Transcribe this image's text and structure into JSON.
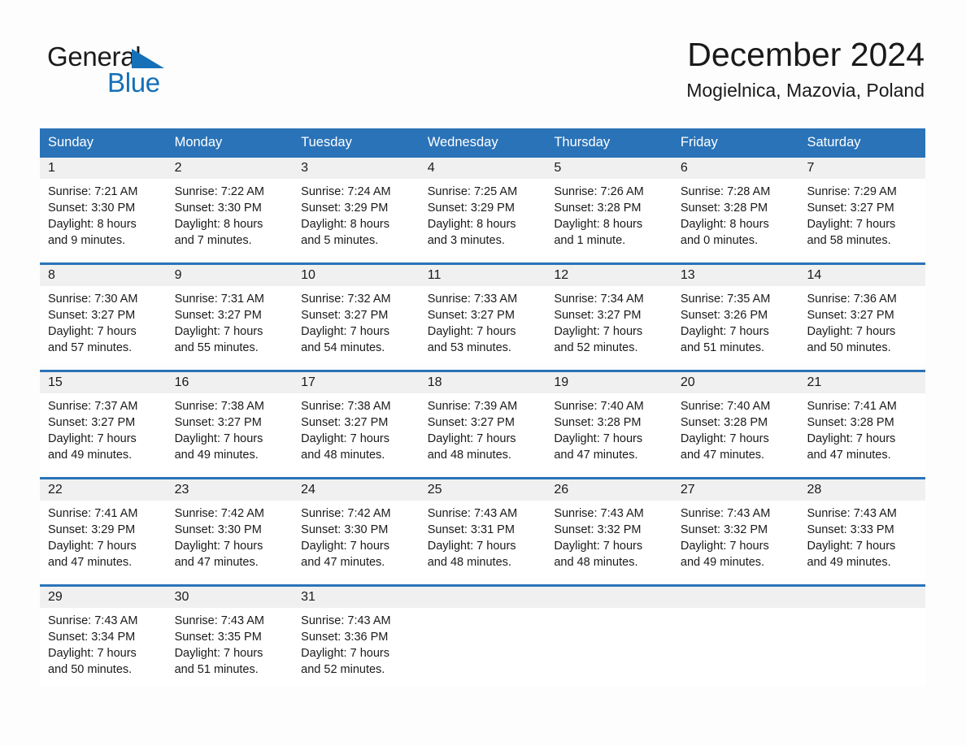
{
  "brand": {
    "name_dark": "General",
    "name_light": "Blue",
    "accent_color": "#1570b8"
  },
  "header": {
    "title": "December 2024",
    "subtitle": "Mogielnica, Mazovia, Poland"
  },
  "calendar": {
    "header_bg": "#2a73b8",
    "day_band_bg": "#f0f0f0",
    "weekday_headers": [
      "Sunday",
      "Monday",
      "Tuesday",
      "Wednesday",
      "Thursday",
      "Friday",
      "Saturday"
    ],
    "weeks": [
      [
        {
          "date": "1",
          "sunrise": "Sunrise: 7:21 AM",
          "sunset": "Sunset: 3:30 PM",
          "daylight_line1": "Daylight: 8 hours",
          "daylight_line2": "and 9 minutes."
        },
        {
          "date": "2",
          "sunrise": "Sunrise: 7:22 AM",
          "sunset": "Sunset: 3:30 PM",
          "daylight_line1": "Daylight: 8 hours",
          "daylight_line2": "and 7 minutes."
        },
        {
          "date": "3",
          "sunrise": "Sunrise: 7:24 AM",
          "sunset": "Sunset: 3:29 PM",
          "daylight_line1": "Daylight: 8 hours",
          "daylight_line2": "and 5 minutes."
        },
        {
          "date": "4",
          "sunrise": "Sunrise: 7:25 AM",
          "sunset": "Sunset: 3:29 PM",
          "daylight_line1": "Daylight: 8 hours",
          "daylight_line2": "and 3 minutes."
        },
        {
          "date": "5",
          "sunrise": "Sunrise: 7:26 AM",
          "sunset": "Sunset: 3:28 PM",
          "daylight_line1": "Daylight: 8 hours",
          "daylight_line2": "and 1 minute."
        },
        {
          "date": "6",
          "sunrise": "Sunrise: 7:28 AM",
          "sunset": "Sunset: 3:28 PM",
          "daylight_line1": "Daylight: 8 hours",
          "daylight_line2": "and 0 minutes."
        },
        {
          "date": "7",
          "sunrise": "Sunrise: 7:29 AM",
          "sunset": "Sunset: 3:27 PM",
          "daylight_line1": "Daylight: 7 hours",
          "daylight_line2": "and 58 minutes."
        }
      ],
      [
        {
          "date": "8",
          "sunrise": "Sunrise: 7:30 AM",
          "sunset": "Sunset: 3:27 PM",
          "daylight_line1": "Daylight: 7 hours",
          "daylight_line2": "and 57 minutes."
        },
        {
          "date": "9",
          "sunrise": "Sunrise: 7:31 AM",
          "sunset": "Sunset: 3:27 PM",
          "daylight_line1": "Daylight: 7 hours",
          "daylight_line2": "and 55 minutes."
        },
        {
          "date": "10",
          "sunrise": "Sunrise: 7:32 AM",
          "sunset": "Sunset: 3:27 PM",
          "daylight_line1": "Daylight: 7 hours",
          "daylight_line2": "and 54 minutes."
        },
        {
          "date": "11",
          "sunrise": "Sunrise: 7:33 AM",
          "sunset": "Sunset: 3:27 PM",
          "daylight_line1": "Daylight: 7 hours",
          "daylight_line2": "and 53 minutes."
        },
        {
          "date": "12",
          "sunrise": "Sunrise: 7:34 AM",
          "sunset": "Sunset: 3:27 PM",
          "daylight_line1": "Daylight: 7 hours",
          "daylight_line2": "and 52 minutes."
        },
        {
          "date": "13",
          "sunrise": "Sunrise: 7:35 AM",
          "sunset": "Sunset: 3:26 PM",
          "daylight_line1": "Daylight: 7 hours",
          "daylight_line2": "and 51 minutes."
        },
        {
          "date": "14",
          "sunrise": "Sunrise: 7:36 AM",
          "sunset": "Sunset: 3:27 PM",
          "daylight_line1": "Daylight: 7 hours",
          "daylight_line2": "and 50 minutes."
        }
      ],
      [
        {
          "date": "15",
          "sunrise": "Sunrise: 7:37 AM",
          "sunset": "Sunset: 3:27 PM",
          "daylight_line1": "Daylight: 7 hours",
          "daylight_line2": "and 49 minutes."
        },
        {
          "date": "16",
          "sunrise": "Sunrise: 7:38 AM",
          "sunset": "Sunset: 3:27 PM",
          "daylight_line1": "Daylight: 7 hours",
          "daylight_line2": "and 49 minutes."
        },
        {
          "date": "17",
          "sunrise": "Sunrise: 7:38 AM",
          "sunset": "Sunset: 3:27 PM",
          "daylight_line1": "Daylight: 7 hours",
          "daylight_line2": "and 48 minutes."
        },
        {
          "date": "18",
          "sunrise": "Sunrise: 7:39 AM",
          "sunset": "Sunset: 3:27 PM",
          "daylight_line1": "Daylight: 7 hours",
          "daylight_line2": "and 48 minutes."
        },
        {
          "date": "19",
          "sunrise": "Sunrise: 7:40 AM",
          "sunset": "Sunset: 3:28 PM",
          "daylight_line1": "Daylight: 7 hours",
          "daylight_line2": "and 47 minutes."
        },
        {
          "date": "20",
          "sunrise": "Sunrise: 7:40 AM",
          "sunset": "Sunset: 3:28 PM",
          "daylight_line1": "Daylight: 7 hours",
          "daylight_line2": "and 47 minutes."
        },
        {
          "date": "21",
          "sunrise": "Sunrise: 7:41 AM",
          "sunset": "Sunset: 3:28 PM",
          "daylight_line1": "Daylight: 7 hours",
          "daylight_line2": "and 47 minutes."
        }
      ],
      [
        {
          "date": "22",
          "sunrise": "Sunrise: 7:41 AM",
          "sunset": "Sunset: 3:29 PM",
          "daylight_line1": "Daylight: 7 hours",
          "daylight_line2": "and 47 minutes."
        },
        {
          "date": "23",
          "sunrise": "Sunrise: 7:42 AM",
          "sunset": "Sunset: 3:30 PM",
          "daylight_line1": "Daylight: 7 hours",
          "daylight_line2": "and 47 minutes."
        },
        {
          "date": "24",
          "sunrise": "Sunrise: 7:42 AM",
          "sunset": "Sunset: 3:30 PM",
          "daylight_line1": "Daylight: 7 hours",
          "daylight_line2": "and 47 minutes."
        },
        {
          "date": "25",
          "sunrise": "Sunrise: 7:43 AM",
          "sunset": "Sunset: 3:31 PM",
          "daylight_line1": "Daylight: 7 hours",
          "daylight_line2": "and 48 minutes."
        },
        {
          "date": "26",
          "sunrise": "Sunrise: 7:43 AM",
          "sunset": "Sunset: 3:32 PM",
          "daylight_line1": "Daylight: 7 hours",
          "daylight_line2": "and 48 minutes."
        },
        {
          "date": "27",
          "sunrise": "Sunrise: 7:43 AM",
          "sunset": "Sunset: 3:32 PM",
          "daylight_line1": "Daylight: 7 hours",
          "daylight_line2": "and 49 minutes."
        },
        {
          "date": "28",
          "sunrise": "Sunrise: 7:43 AM",
          "sunset": "Sunset: 3:33 PM",
          "daylight_line1": "Daylight: 7 hours",
          "daylight_line2": "and 49 minutes."
        }
      ],
      [
        {
          "date": "29",
          "sunrise": "Sunrise: 7:43 AM",
          "sunset": "Sunset: 3:34 PM",
          "daylight_line1": "Daylight: 7 hours",
          "daylight_line2": "and 50 minutes."
        },
        {
          "date": "30",
          "sunrise": "Sunrise: 7:43 AM",
          "sunset": "Sunset: 3:35 PM",
          "daylight_line1": "Daylight: 7 hours",
          "daylight_line2": "and 51 minutes."
        },
        {
          "date": "31",
          "sunrise": "Sunrise: 7:43 AM",
          "sunset": "Sunset: 3:36 PM",
          "daylight_line1": "Daylight: 7 hours",
          "daylight_line2": "and 52 minutes."
        },
        {
          "date": "",
          "sunrise": "",
          "sunset": "",
          "daylight_line1": "",
          "daylight_line2": ""
        },
        {
          "date": "",
          "sunrise": "",
          "sunset": "",
          "daylight_line1": "",
          "daylight_line2": ""
        },
        {
          "date": "",
          "sunrise": "",
          "sunset": "",
          "daylight_line1": "",
          "daylight_line2": ""
        },
        {
          "date": "",
          "sunrise": "",
          "sunset": "",
          "daylight_line1": "",
          "daylight_line2": ""
        }
      ]
    ]
  }
}
